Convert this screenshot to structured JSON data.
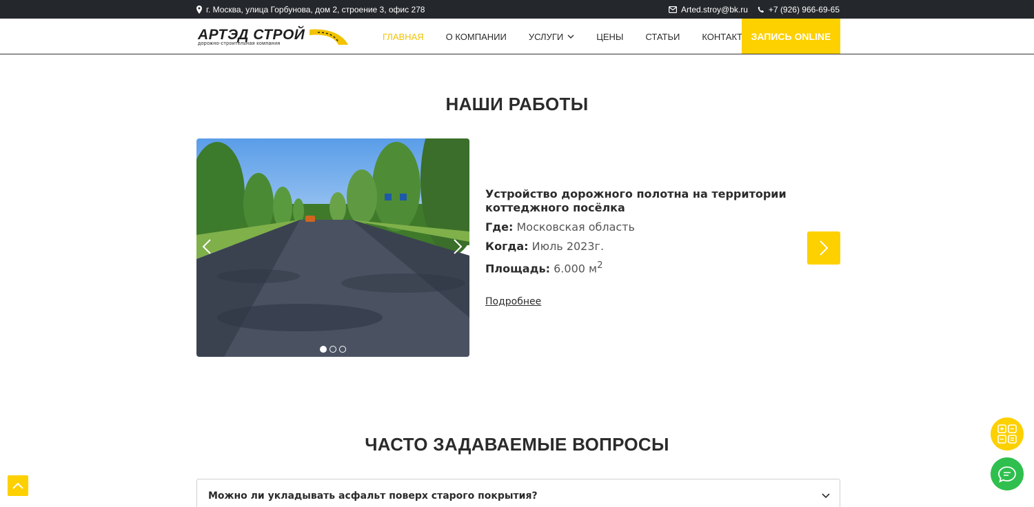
{
  "topbar": {
    "address": "г. Москва, улица Горбунова, дом 2, строение 3, офис 278",
    "email": "Arted.stroy@bk.ru",
    "phone": "+7 (926) 966-69-65"
  },
  "header": {
    "logo_text": "АРТЭД СТРОЙ",
    "logo_tagline": "дорожно-строительная компания",
    "nav": [
      {
        "label": "Главная",
        "active": true
      },
      {
        "label": "О компании"
      },
      {
        "label": "Услуги"
      },
      {
        "label": "Цены"
      },
      {
        "label": "Статьи"
      },
      {
        "label": "Контакты"
      }
    ],
    "cta_label": "Запись online"
  },
  "works": {
    "title": "Наши работы",
    "item": {
      "title": "Устройство дорожного полотна на территории коттеджного посёлка",
      "where_label": "Где:",
      "where_value": "Московская область",
      "when_label": "Когда:",
      "when_value": "Июль 2023г.",
      "area_label": "Площадь:",
      "area_value": "6.000 м",
      "area_sup": "2",
      "more_label": "Подробнее"
    },
    "slides_total": 3,
    "active_slide": 1
  },
  "faq": {
    "title": "Часто задаваемые вопросы",
    "items": [
      {
        "question": "Можно ли укладывать асфальт поверх старого покрытия?"
      }
    ]
  },
  "colors": {
    "accent": "#fdd000",
    "topbar": "#24272b",
    "chat": "#2fbf4e"
  }
}
